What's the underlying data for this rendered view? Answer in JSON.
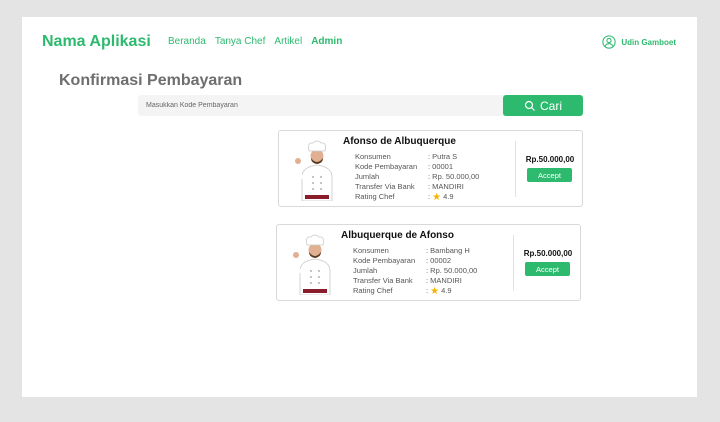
{
  "header": {
    "brand": "Nama Aplikasi",
    "nav": [
      "Beranda",
      "Tanya Chef",
      "Artikel",
      "Admin"
    ],
    "active_nav": "Admin",
    "user_name": "Udin Gamboet"
  },
  "main": {
    "title": "Konfirmasi Pembayaran",
    "search": {
      "placeholder": "Masukkan Kode Pembayaran",
      "button_label": "Cari"
    },
    "cards": [
      {
        "chef_name": "Afonso de Albuquerque",
        "konsumen_label": "Konsumen",
        "konsumen_value": ": Putra S",
        "kode_label": "Kode Pembayaran",
        "kode_value": ": 00001",
        "jumlah_label": "Jumlah",
        "jumlah_value": ": Rp. 50.000,00",
        "bank_label": "Transfer Via Bank",
        "bank_value": ": MANDIRI",
        "rating_label": "Rating Chef",
        "rating_prefix": ":",
        "rating_value": "4.9",
        "price": "Rp.50.000,00",
        "accept_label": "Accept"
      },
      {
        "chef_name": "Albuquerque de Afonso",
        "konsumen_label": "Konsumen",
        "konsumen_value": ": Bambang H",
        "kode_label": "Kode Pembayaran",
        "kode_value": ": 00002",
        "jumlah_label": "Jumlah",
        "jumlah_value": ": Rp. 50.000,00",
        "bank_label": "Transfer Via Bank",
        "bank_value": ": MANDIRI",
        "rating_label": "Rating Chef",
        "rating_prefix": ":",
        "rating_value": "4.9",
        "price": "Rp.50.000,00",
        "accept_label": "Accept"
      }
    ]
  },
  "colors": {
    "accent": "#2dba6e",
    "background": "#e4e4e4",
    "star": "#f5b400"
  }
}
